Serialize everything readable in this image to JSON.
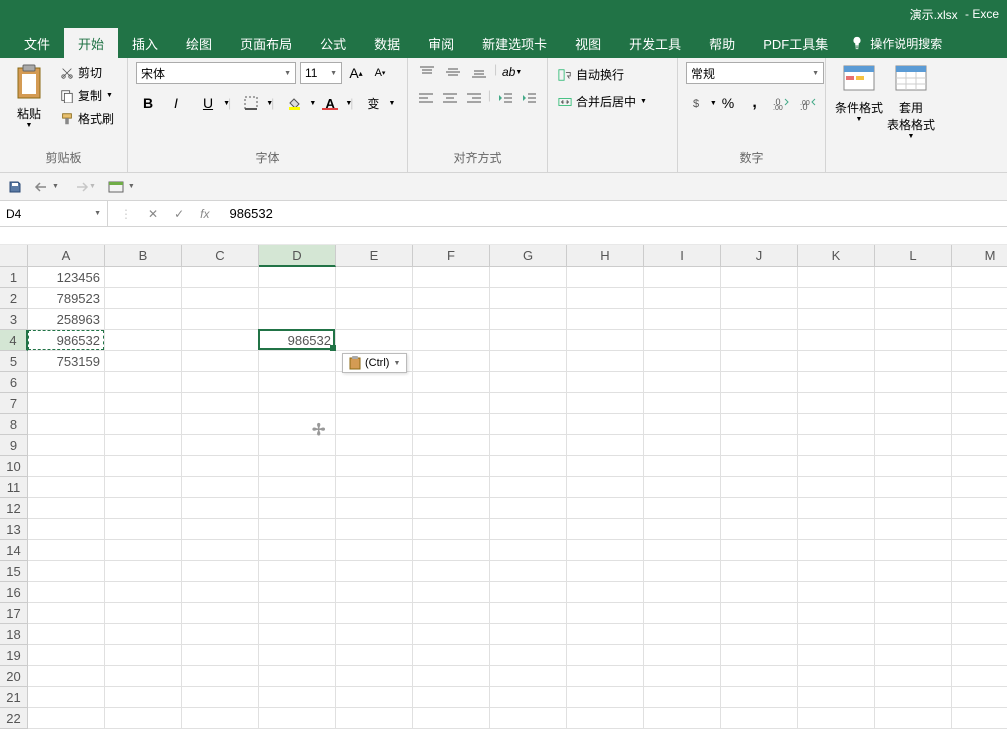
{
  "title": {
    "filename": "演示.xlsx",
    "app": "Exce"
  },
  "tabs": {
    "file": "文件",
    "home": "开始",
    "insert": "插入",
    "draw": "绘图",
    "layout": "页面布局",
    "formulas": "公式",
    "data": "数据",
    "review": "审阅",
    "newtab": "新建选项卡",
    "view": "视图",
    "dev": "开发工具",
    "help": "帮助",
    "pdf": "PDF工具集",
    "tellme": "操作说明搜索"
  },
  "clipboard": {
    "paste": "粘贴",
    "cut": "剪切",
    "copy": "复制",
    "format_painter": "格式刷",
    "group_label": "剪贴板"
  },
  "font": {
    "name": "宋体",
    "size": "11",
    "group_label": "字体",
    "bold": "B",
    "italic": "I",
    "underline": "U",
    "color_letter": "A",
    "pinyin_letter": "变"
  },
  "alignment": {
    "group_label": "对齐方式",
    "wrap_text": "自动换行",
    "merge": "合并后居中"
  },
  "number": {
    "format": "常规",
    "group_label": "数字",
    "percent": "%",
    "comma": ","
  },
  "styles": {
    "conditional": "条件格式",
    "table_format": "套用\n表格格式"
  },
  "name_box": "D4",
  "formula_value": "986532",
  "columns": [
    "A",
    "B",
    "C",
    "D",
    "E",
    "F",
    "G",
    "H",
    "I",
    "J",
    "K",
    "L",
    "M"
  ],
  "row_count": 22,
  "cells": {
    "A1": "123456",
    "A2": "789523",
    "A3": "258963",
    "A4": "986532",
    "A5": "753159",
    "D4": "986532"
  },
  "active": {
    "col": 3,
    "row": 3
  },
  "marching": {
    "col": 0,
    "row": 3
  },
  "paste_tag": "(Ctrl)"
}
